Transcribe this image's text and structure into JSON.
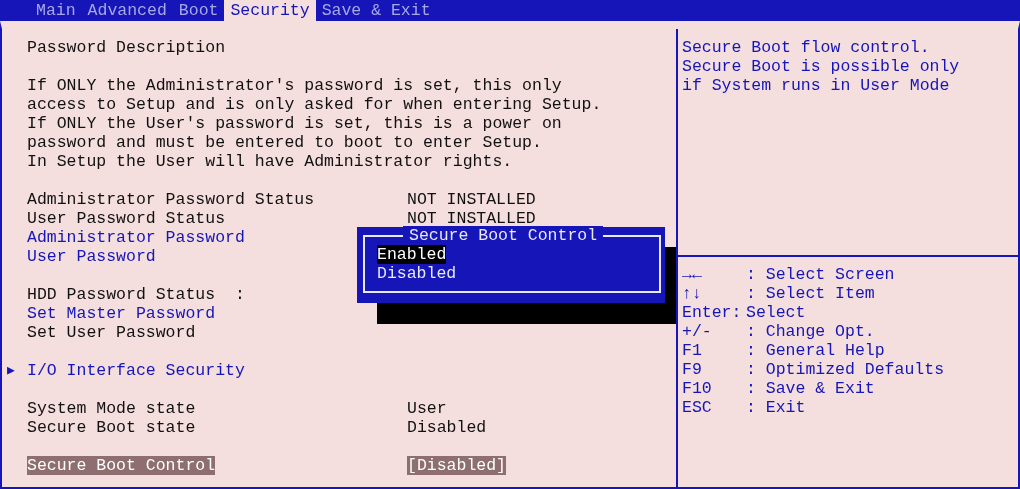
{
  "tabs": [
    {
      "label": "Main",
      "selected": false
    },
    {
      "label": "Advanced",
      "selected": false
    },
    {
      "label": "Boot",
      "selected": false
    },
    {
      "label": "Security",
      "selected": true
    },
    {
      "label": "Save & Exit",
      "selected": false
    }
  ],
  "items": [
    {
      "kind": "heading",
      "label": "Password Description"
    },
    {
      "kind": "blank"
    },
    {
      "kind": "text",
      "label": "If ONLY the Administrator's password is set, this only"
    },
    {
      "kind": "text",
      "label": "access to Setup and is only asked for when entering Setup."
    },
    {
      "kind": "text",
      "label": "If ONLY the User's password is set, this is a power on"
    },
    {
      "kind": "text",
      "label": "password and must be entered to boot to enter Setup."
    },
    {
      "kind": "text",
      "label": "In Setup the User will have Administrator rights."
    },
    {
      "kind": "blank"
    },
    {
      "kind": "status",
      "label": "Administrator Password Status",
      "value": "NOT INSTALLED"
    },
    {
      "kind": "status",
      "label": "User Password Status",
      "value": "NOT INSTALLED"
    },
    {
      "kind": "option",
      "label": "Administrator Password",
      "selected": false
    },
    {
      "kind": "option",
      "label": "User Password",
      "selected": false
    },
    {
      "kind": "blank"
    },
    {
      "kind": "text",
      "label": "HDD Password Status  :"
    },
    {
      "kind": "option",
      "label": "Set Master Password",
      "selected": false
    },
    {
      "kind": "text",
      "label": "Set User Password"
    },
    {
      "kind": "blank"
    },
    {
      "kind": "submenu",
      "marker": "▶",
      "label": "I/O Interface Security",
      "selected": false
    },
    {
      "kind": "blank"
    },
    {
      "kind": "status",
      "label": "System Mode state",
      "value": "User"
    },
    {
      "kind": "status",
      "label": "Secure Boot state",
      "value": "Disabled"
    },
    {
      "kind": "blank"
    },
    {
      "kind": "option",
      "label": "Secure Boot Control",
      "value": "[Disabled]",
      "selected": true
    }
  ],
  "popup": {
    "title": "Secure Boot Control",
    "options": [
      {
        "label": "Enabled",
        "selected": true
      },
      {
        "label": "Disabled",
        "selected": false
      }
    ]
  },
  "help_text": [
    "Secure Boot flow control.",
    "Secure Boot is possible only",
    "if System runs in User Mode"
  ],
  "keys": [
    {
      "key": "→←",
      "action": ": Select Screen"
    },
    {
      "key": "↑↓",
      "action": ": Select Item"
    },
    {
      "key": "Enter:",
      "action": "Select"
    },
    {
      "key": "+/-",
      "action": ": Change Opt."
    },
    {
      "key": "F1",
      "action": ": General Help"
    },
    {
      "key": "F9",
      "action": ": Optimized Defaults"
    },
    {
      "key": "F10",
      "action": ": Save & Exit"
    },
    {
      "key": "ESC",
      "action": ": Exit"
    }
  ]
}
